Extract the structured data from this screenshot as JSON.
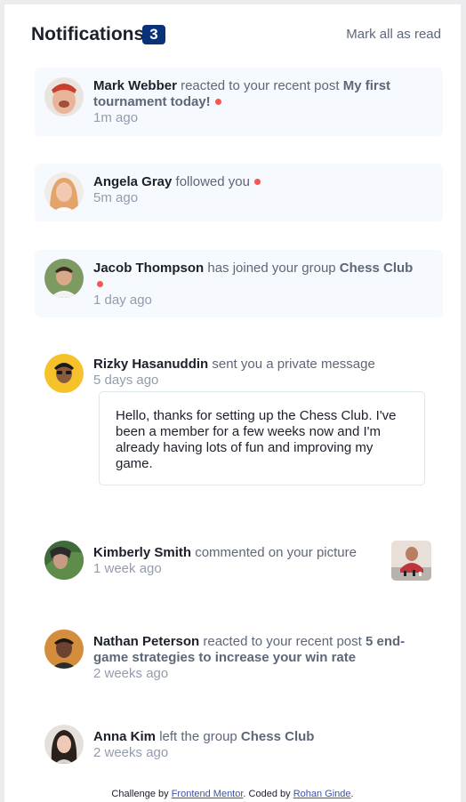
{
  "header": {
    "title": "Notifications",
    "unread_count": "3",
    "mark_all": "Mark all as read"
  },
  "notifications": [
    {
      "name": "Mark Webber",
      "action": "reacted to your recent post",
      "target": "My first tournament today!",
      "time": "1m ago",
      "unread": true
    },
    {
      "name": "Angela Gray",
      "action": "followed you",
      "target": "",
      "time": "5m ago",
      "unread": true
    },
    {
      "name": "Jacob Thompson",
      "action": "has joined your group",
      "target": "Chess Club",
      "time": "1 day ago",
      "unread": true
    },
    {
      "name": "Rizky Hasanuddin",
      "action": "sent you a private message",
      "target": "",
      "time": "5 days ago",
      "unread": false,
      "message": "Hello, thanks for setting up the Chess Club. I've been a member for a few weeks now and I'm already having lots of fun and improving my game."
    },
    {
      "name": "Kimberly Smith",
      "action": "commented on your picture",
      "target": "",
      "time": "1 week ago",
      "unread": false
    },
    {
      "name": "Nathan Peterson",
      "action": "reacted to your recent post",
      "target": "5 end-game strategies to increase your win rate",
      "time": "2 weeks ago",
      "unread": false
    },
    {
      "name": "Anna Kim",
      "action": "left the group",
      "target": "Chess Club",
      "time": "2 weeks ago",
      "unread": false
    }
  ],
  "footer": {
    "prefix": "Challenge by",
    "fm_link": "Frontend Mentor",
    "middle": ". Coded by",
    "author_link": "Rohan Ginde",
    "suffix": "."
  },
  "colors": {
    "badge": "#0a327b",
    "unread_bg": "#f6f9fd",
    "dot": "#f65552",
    "name": "#1c202b",
    "muted": "#5e6778",
    "time": "#939cad"
  }
}
